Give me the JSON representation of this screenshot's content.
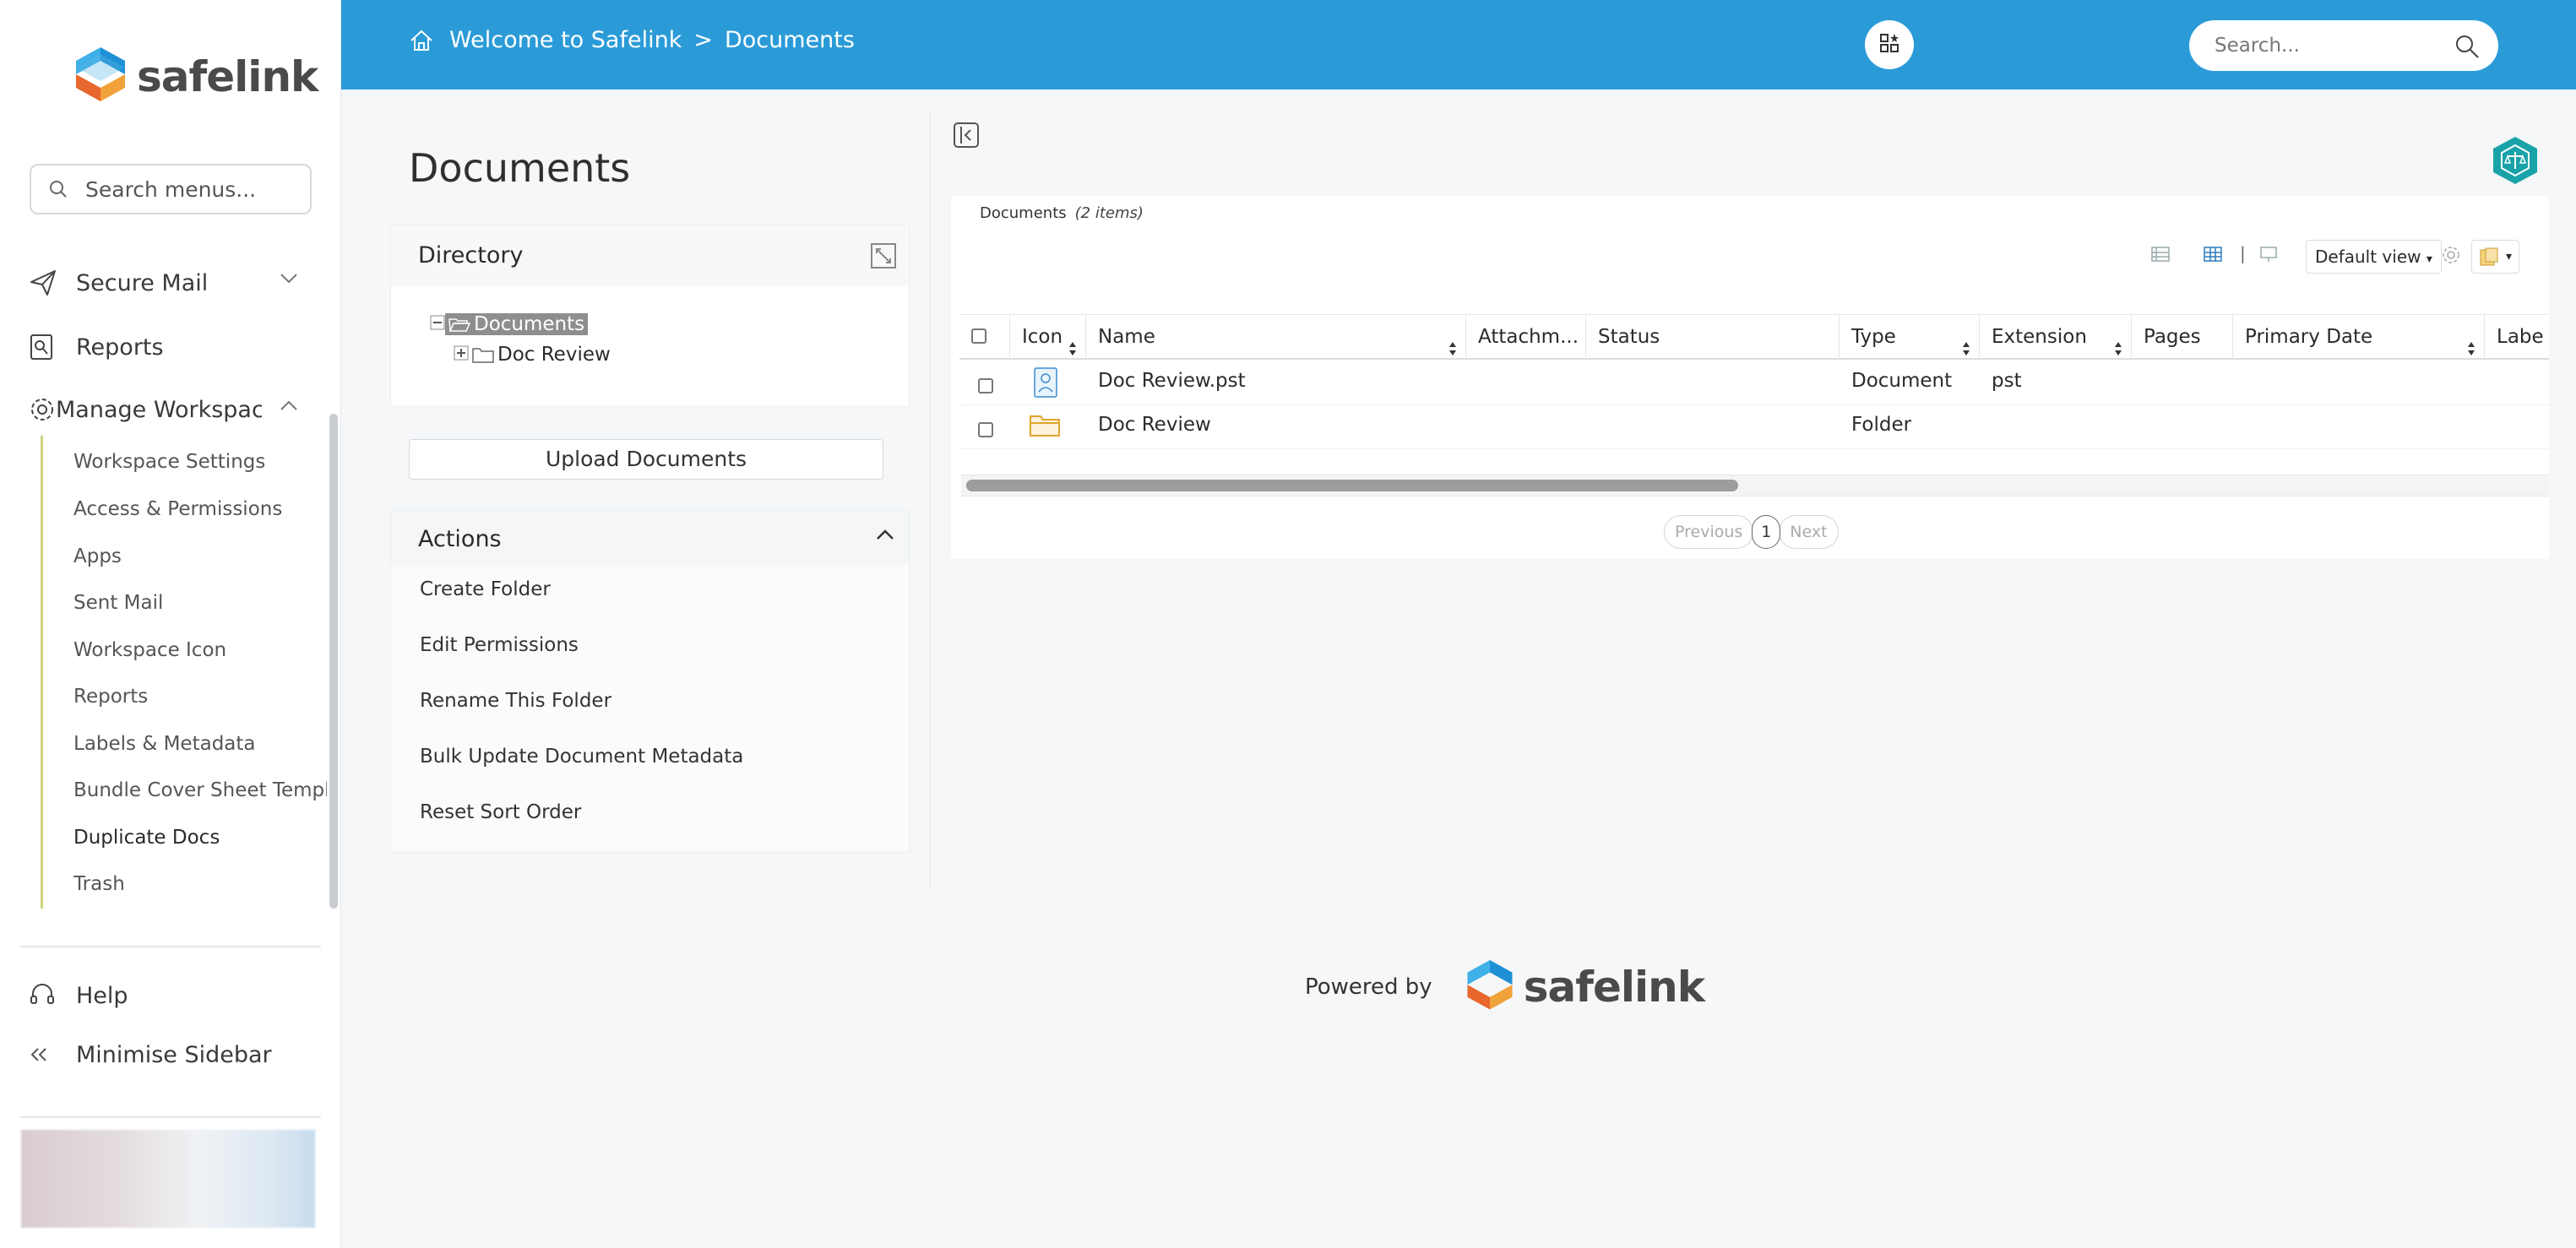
{
  "brand": {
    "name": "safelink"
  },
  "sidebar": {
    "search_placeholder": "Search menus...",
    "items": [
      {
        "label": "Secure Mail",
        "icon": "paper-plane-icon"
      },
      {
        "label": "Reports",
        "icon": "report-icon"
      },
      {
        "label": "Manage Workspace",
        "icon": "gear-icon"
      }
    ],
    "submenu": [
      "Workspace Settings",
      "Access & Permissions",
      "Apps",
      "Sent Mail",
      "Workspace Icon",
      "Reports",
      "Labels & Metadata",
      "Bundle Cover Sheet Templates",
      "Duplicate Docs",
      "Trash"
    ],
    "help_label": "Help",
    "minimise_label": "Minimise Sidebar"
  },
  "topbar": {
    "breadcrumb": [
      "Welcome to Safelink",
      ">",
      "Documents"
    ],
    "search_placeholder": "Search..."
  },
  "page": {
    "title": "Documents"
  },
  "directory": {
    "title": "Directory",
    "tree": [
      {
        "label": "Documents",
        "selected": true
      },
      {
        "label": "Doc Review",
        "selected": false
      }
    ]
  },
  "upload_label": "Upload Documents",
  "actions": {
    "title": "Actions",
    "items": [
      "Create Folder",
      "Edit Permissions",
      "Rename This Folder",
      "Bulk Update Document Metadata",
      "Reset Sort Order"
    ]
  },
  "grid": {
    "caption": "Documents",
    "count": "(2 items)",
    "view_select": "Default view",
    "columns": [
      "Icon",
      "Name",
      "Attachm...",
      "Status",
      "Type",
      "Extension",
      "Pages",
      "Primary Date",
      "Labe"
    ],
    "rows": [
      {
        "name": "Doc Review.pst",
        "type": "Document",
        "extension": "pst",
        "icon": "document-icon"
      },
      {
        "name": "Doc Review",
        "type": "Folder",
        "extension": "",
        "icon": "folder-icon"
      }
    ],
    "pager": {
      "previous": "Previous",
      "current": "1",
      "next": "Next"
    }
  },
  "footer": {
    "powered_by": "Powered by"
  },
  "colors": {
    "accent": "#2b9bd8",
    "submenu_line": "#cfd47c"
  }
}
